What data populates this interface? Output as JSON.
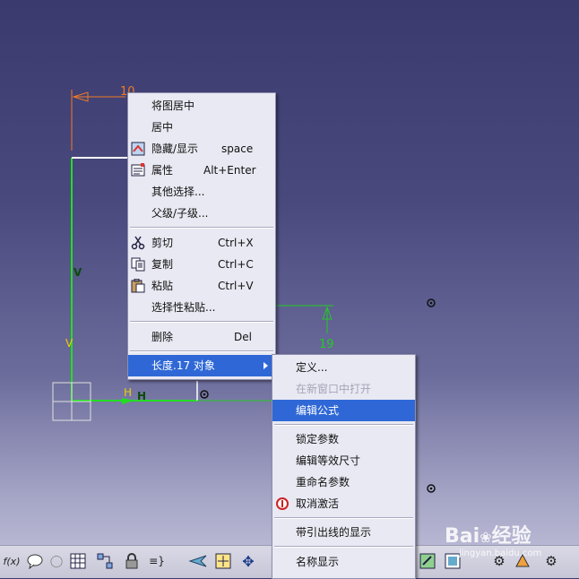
{
  "sketch": {
    "dim_top": "10",
    "dim_right": "19",
    "label_v": "V",
    "label_h": "H"
  },
  "context_menu": {
    "items": [
      {
        "label": "将图居中",
        "shortcut": ""
      },
      {
        "label": "居中",
        "shortcut": ""
      },
      {
        "label": "隐藏/显示",
        "shortcut": "space",
        "icon": "hide-show-icon"
      },
      {
        "label": "属性",
        "shortcut": "Alt+Enter",
        "icon": "properties-icon"
      },
      {
        "label": "其他选择...",
        "shortcut": ""
      },
      {
        "label": "父级/子级...",
        "shortcut": ""
      },
      {
        "label": "剪切",
        "shortcut": "Ctrl+X",
        "icon": "scissors-icon"
      },
      {
        "label": "复制",
        "shortcut": "Ctrl+C",
        "icon": "copy-icon"
      },
      {
        "label": "粘贴",
        "shortcut": "Ctrl+V",
        "icon": "paste-icon"
      },
      {
        "label": "选择性粘贴...",
        "shortcut": ""
      },
      {
        "label": "删除",
        "shortcut": "Del"
      },
      {
        "label": "长度.17 对象",
        "shortcut": ""
      }
    ]
  },
  "submenu": {
    "items": [
      {
        "label": "定义..."
      },
      {
        "label": "在新窗口中打开",
        "disabled": true
      },
      {
        "label": "编辑公式",
        "selected": true
      },
      {
        "label": "锁定参数"
      },
      {
        "label": "编辑等效尺寸"
      },
      {
        "label": "重命名参数"
      },
      {
        "label": "取消激活",
        "icon": "deactivate-icon"
      },
      {
        "label": "带引出线的显示"
      },
      {
        "label": "名称显示"
      }
    ]
  },
  "toolbar": {
    "formula_label": "f(x)"
  },
  "watermark": {
    "brand": "Bai",
    "brand2": "经验",
    "url": "jingyan.baidu.com"
  },
  "colors": {
    "selection": "#2f68d6",
    "geometry_green": "#22dd22",
    "dimension_orange": "#f07a22",
    "dimension_green": "#22cc22"
  }
}
